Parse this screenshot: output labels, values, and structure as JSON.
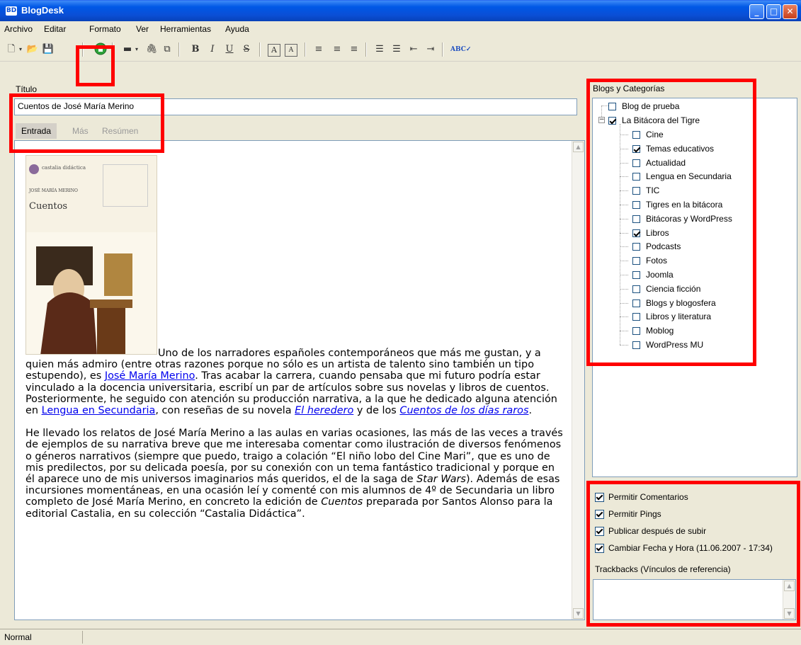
{
  "window": {
    "title": "BlogDesk",
    "app_icon_text": "BD"
  },
  "menu": [
    "Archivo",
    "Editar",
    "Formato",
    "Ver",
    "Herramientas",
    "Ayuda"
  ],
  "toolbar": {
    "bold": "B",
    "italic": "I",
    "underline": "U",
    "strike": "S"
  },
  "post": {
    "title_label": "Título",
    "title_value": "Cuentos de José María Merino",
    "tabs": [
      "Entrada",
      "Más",
      "Resúmen"
    ],
    "book_cover": {
      "publisher": "castalia didáctica",
      "author": "JOSÉ MARÍA MERINO",
      "title": "Cuentos"
    },
    "p1_a": "Uno de los narradores españoles contemporáneos que más me gustan, y a quien más admiro (entre otras razones porque no sólo es un artista de talento sino también un tipo estupendo), es ",
    "p1_link1": "José María Merino",
    "p1_b": ". Tras acabar la carrera, cuando pensaba que mi futuro podría estar vinculado a la docencia universitaria, escribí un par de artículos sobre sus novelas y libros de cuentos. Posteriormente, he seguido con atención su producción narrativa, a la que he dedicado alguna atención en ",
    "p1_link2": "Lengua en Secundaria",
    "p1_c": ", con reseñas de su novela ",
    "p1_link3": "El heredero",
    "p1_d": " y de los ",
    "p1_link4": "Cuentos de los días raros",
    "p1_e": ".",
    "p2_a": "He llevado los relatos de José María Merino a las aulas en varias ocasiones, las más de las veces a través de ejemplos de su narrativa breve que me interesaba comentar como ilustración de diversos fenómenos o géneros narrativos (siempre que puedo, traigo a colación “El niño lobo del Cine Mari”, que es uno de mis predilectos, por su delicada poesía, por su conexión con un tema fantástico tradicional y porque en él aparece uno de mis universos imaginarios más queridos, el de la saga de ",
    "p2_em1": "Star Wars",
    "p2_b": "). Además de esas incursiones momentáneas, en una ocasión leí y comenté con mis alumnos de 4º de Secundaria un libro completo de José María Merino, en concreto la edición de ",
    "p2_em2": "Cuentos",
    "p2_c": " preparada por Santos Alonso para la editorial Castalia, en su colección “Castalia Didáctica”."
  },
  "blogs_panel": {
    "label": "Blogs y Categorías",
    "blogs": [
      {
        "name": "Blog de prueba",
        "checked": false
      },
      {
        "name": "La Bitácora del Tigre",
        "checked": true,
        "expanded": true,
        "categories": [
          {
            "name": "Cine",
            "checked": false
          },
          {
            "name": "Temas educativos",
            "checked": true
          },
          {
            "name": "Actualidad",
            "checked": false
          },
          {
            "name": "Lengua en Secundaria",
            "checked": false
          },
          {
            "name": "TIC",
            "checked": false
          },
          {
            "name": "Tigres en la bitácora",
            "checked": false
          },
          {
            "name": "Bitácoras y WordPress",
            "checked": false
          },
          {
            "name": "Libros",
            "checked": true
          },
          {
            "name": "Podcasts",
            "checked": false
          },
          {
            "name": "Fotos",
            "checked": false
          },
          {
            "name": "Joomla",
            "checked": false
          },
          {
            "name": "Ciencia ficción",
            "checked": false
          },
          {
            "name": "Blogs y blogosfera",
            "checked": false
          },
          {
            "name": "Libros y literatura",
            "checked": false
          },
          {
            "name": "Moblog",
            "checked": false
          },
          {
            "name": "WordPress MU",
            "checked": false
          }
        ]
      }
    ]
  },
  "options": {
    "allow_comments": "Permitir Comentarios",
    "allow_pings": "Permitir Pings",
    "publish_after_upload": "Publicar después de subir",
    "change_date": "Cambiar Fecha y Hora (11.06.2007 - 17:34)",
    "trackbacks_label": "Trackbacks (Vínculos de referencia)"
  },
  "status": {
    "text": "Normal"
  },
  "colors": {
    "highlight": "#ff0000",
    "link": "#0000ee",
    "titlebar": "#0a4fd6"
  }
}
